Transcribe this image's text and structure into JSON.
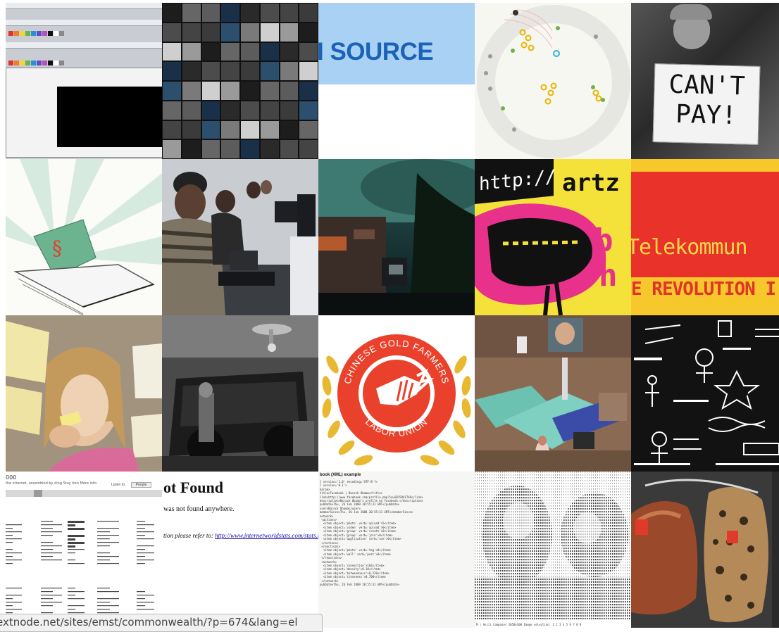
{
  "tiles": {
    "app_screenshot": {
      "swatch_colors": [
        "#e0332b",
        "#f07b2a",
        "#f6d23b",
        "#68b34a",
        "#2c8fd6",
        "#5b4fc2",
        "#b84fbd",
        "#111111",
        "#ffffff",
        "#888888"
      ]
    },
    "open_source": {
      "text": "I SOURCE",
      "band_color": "#a9d1f3",
      "text_color": "#1b62b8"
    },
    "cant_pay": {
      "sign_text": "CAN'T\nPAY!"
    },
    "http_artz": {
      "http_text": "http://",
      "artz_text": "artz",
      "bg_color": "#f4e23a",
      "accent_color": "#e7318a"
    },
    "telekommunisten": {
      "big_text": "Telekommun",
      "small_text": "E REVOLUTION I",
      "red": "#e9322a",
      "yellow": "#f6c82b"
    },
    "gold_farmers": {
      "top_text": "CHINESE GOLD FARMERS",
      "bottom_text": "LABOR UNION",
      "red": "#e9412b",
      "gold": "#e8b830"
    },
    "web_page": {
      "header": "000",
      "subtitle": "the internet, assembled by ding Stay tien More info.",
      "listen_label": "Listen to:",
      "listen_value": "People"
    },
    "not_found": {
      "heading": "ot Found",
      "line1": "was not found anywhere.",
      "line2_prefix": "tion please refer to:",
      "line2_link": "http://www.internetworldstats.com/stats.htm"
    },
    "xml_code": {
      "header": "book (XML) example",
      "lines": [
        "l version='1.0' encoding='UTF-8'?>",
        "l version='0.1'>",
        "barak>",
        "title>Facebook | Barack Obama</title>",
        "link>http://www.facebook.com/profile.php?id=6815841748</link>",
        "description>Barack Obama's profile on Facebook.</description>",
        "pubDate>Thu, 26 Feb 2009 20:55:31 GMT</pubDate>",
        "user>Barack Obama</user>",
        "memberSince>Thu, 26 Jun 2008 20:55:31 GMT</memberSince>",
        "network>",
        " <actions>",
        "  <item object='photo' verb='upload'>5</item>",
        "  <item object='video' verb='upload'>0</item>",
        "  <item object='group' verb='create'>0</item>",
        "  <item object='group' verb='join'>0</item>",
        "  <item object='application' verb='use'>0</item>",
        " </actions>",
        " <reactions>",
        "  <item object='photo' verb='tag'>0</item>",
        "  <item object='wall' verb='post'>0</item>",
        " </reactions>",
        " <network>",
        "  <item object='connection'>102</item>",
        "  <item object='density'>0.10</item>",
        "  <item object='betweenness'>0.220</item>",
        "  <item object='closeness'>0.700</item>",
        " </network>",
        "pubDate>Thu, 26 Feb 2009 20:55:31 GMT</pubDate>"
      ]
    },
    "ascii_art": {
      "footer": "M | Ascii Composer 1050x300 Image selection: 1 2 3 4 5 6 7 8 9"
    }
  },
  "status_bar": {
    "url": "extnode.net/sites/emst/commonwealth/?p=674&lang=el"
  }
}
